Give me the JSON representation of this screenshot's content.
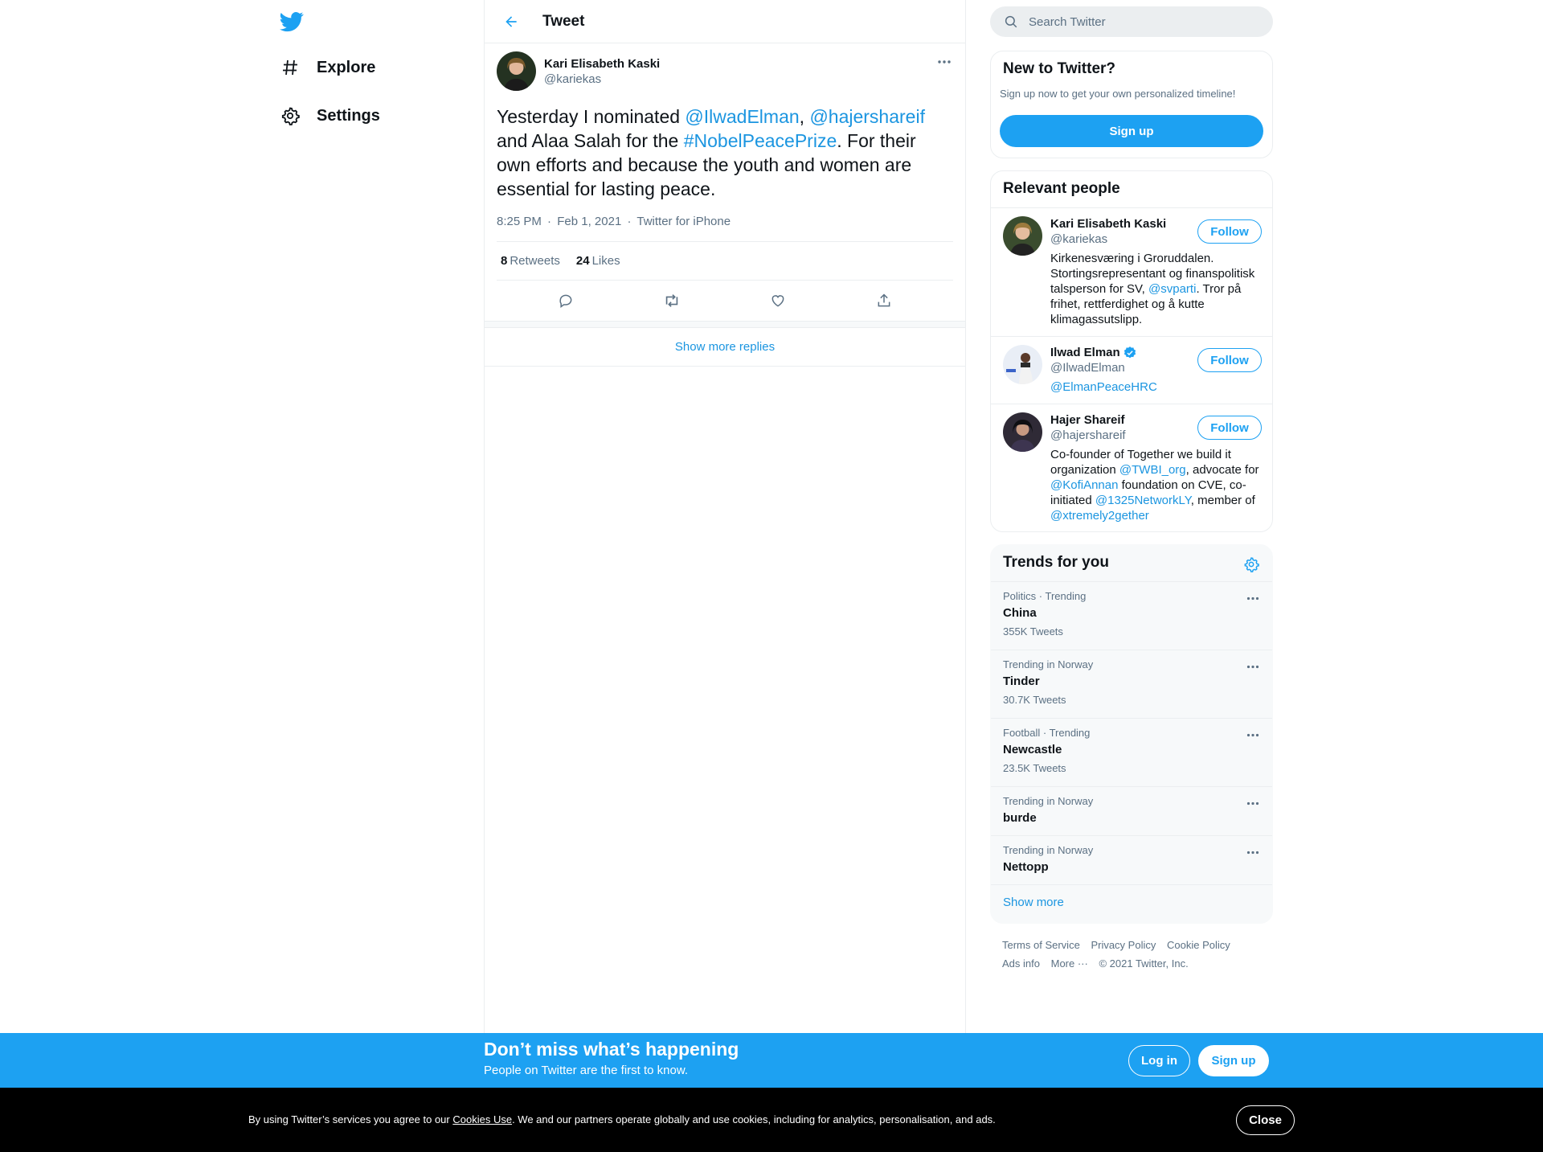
{
  "nav": {
    "items": [
      {
        "label": "Explore",
        "icon": "hashtag-icon"
      },
      {
        "label": "Settings",
        "icon": "gear-icon"
      }
    ]
  },
  "header": {
    "title": "Tweet"
  },
  "tweet": {
    "author_name": "Kari Elisabeth Kaski",
    "author_handle": "@kariekas",
    "text_parts": [
      {
        "t": "Yesterday I nominated ",
        "link": false
      },
      {
        "t": "@IlwadElman",
        "link": true
      },
      {
        "t": ", ",
        "link": false
      },
      {
        "t": "@hajershareif",
        "link": true
      },
      {
        "t": " and Alaa Salah for the ",
        "link": false
      },
      {
        "t": "#NobelPeacePrize",
        "link": true
      },
      {
        "t": ". For their own efforts and because the youth and women are essential for lasting peace.",
        "link": false
      }
    ],
    "time": "8:25 PM",
    "date": "Feb 1, 2021",
    "source": "Twitter for iPhone",
    "separator": "·",
    "retweets_count": "8",
    "retweets_label": "Retweets",
    "likes_count": "24",
    "likes_label": "Likes"
  },
  "replies": {
    "show_more": "Show more replies"
  },
  "search": {
    "placeholder": "Search Twitter"
  },
  "new_to_twitter": {
    "title": "New to Twitter?",
    "subtitle": "Sign up now to get your own personalized timeline!",
    "button": "Sign up"
  },
  "relevant_people": {
    "title": "Relevant people",
    "follow_label": "Follow",
    "people": [
      {
        "name": "Kari Elisabeth Kaski",
        "handle": "@kariekas",
        "verified": false,
        "bio_parts": [
          {
            "t": "Kirkenesværing i Groruddalen. Stortingsrepresentant og finanspolitisk talsperson for SV, ",
            "link": false
          },
          {
            "t": "@svparti",
            "link": true
          },
          {
            "t": ". Tror på frihet, rettferdighet og å kutte klimagassutslipp.",
            "link": false
          }
        ]
      },
      {
        "name": "Ilwad Elman",
        "handle": "@IlwadElman",
        "verified": true,
        "bio_parts": [
          {
            "t": "@ElmanPeaceHRC",
            "link": true
          }
        ]
      },
      {
        "name": "Hajer Shareif",
        "handle": "@hajershareif",
        "verified": false,
        "bio_parts": [
          {
            "t": "Co-founder of Together we build it organization ",
            "link": false
          },
          {
            "t": "@TWBI_org",
            "link": true
          },
          {
            "t": ", advocate for ",
            "link": false
          },
          {
            "t": "@KofiAnnan",
            "link": true
          },
          {
            "t": " foundation on CVE, co-initiated ",
            "link": false
          },
          {
            "t": "@1325NetworkLY",
            "link": true
          },
          {
            "t": ", member of ",
            "link": false
          },
          {
            "t": "@xtremely2gether",
            "link": true
          }
        ]
      }
    ]
  },
  "trends": {
    "title": "Trends for you",
    "items": [
      {
        "context": "Politics · Trending",
        "name": "China",
        "count": "355K Tweets"
      },
      {
        "context": "Trending in Norway",
        "name": "Tinder",
        "count": "30.7K Tweets"
      },
      {
        "context": "Football · Trending",
        "name": "Newcastle",
        "count": "23.5K Tweets"
      },
      {
        "context": "Trending in Norway",
        "name": "burde",
        "count": ""
      },
      {
        "context": "Trending in Norway",
        "name": "Nettopp",
        "count": ""
      }
    ],
    "show_more": "Show more"
  },
  "footer": {
    "terms": "Terms of Service",
    "privacy": "Privacy Policy",
    "cookie": "Cookie Policy",
    "ads": "Ads info",
    "more": "More ···",
    "copyright": "© 2021 Twitter, Inc."
  },
  "banner": {
    "title": "Don’t miss what’s happening",
    "subtitle": "People on Twitter are the first to know.",
    "login": "Log in",
    "signup": "Sign up"
  },
  "cookie": {
    "prefix": "By using Twitter’s services you agree to our ",
    "link": "Cookies Use",
    "suffix": ". We and our partners operate globally and use cookies, including for analytics, personalisation, and ads.",
    "close": "Close"
  },
  "colors": {
    "accent": "#1da1f2",
    "link": "#1b95e0",
    "muted": "#5b7083",
    "cookie_bg": "#000000"
  }
}
